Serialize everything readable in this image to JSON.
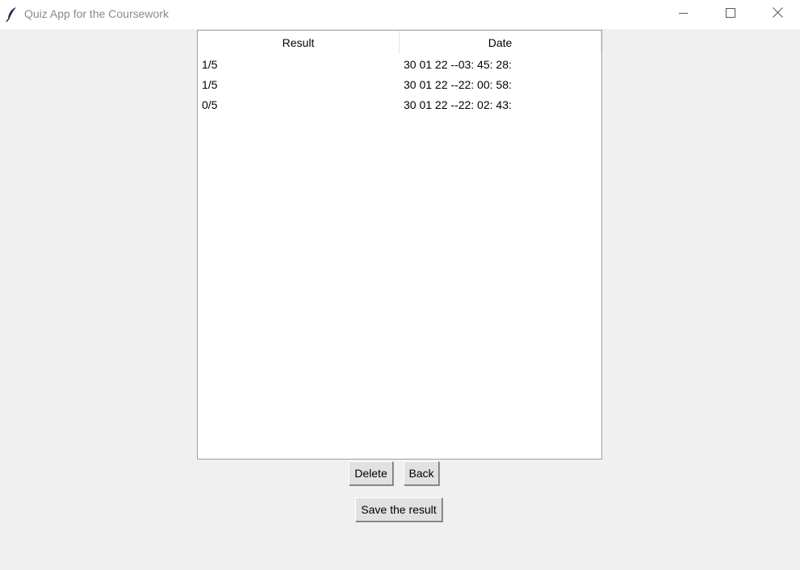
{
  "window": {
    "title": "Quiz App for the Coursework",
    "icon": "feather-icon",
    "controls": [
      "minimize-icon",
      "maximize-icon",
      "close-icon"
    ]
  },
  "table": {
    "columns": [
      "Result",
      "Date"
    ],
    "rows": [
      {
        "result": "1/5",
        "date": "30 01 22 --03: 45: 28:"
      },
      {
        "result": "1/5",
        "date": "30 01 22 --22: 00: 58:"
      },
      {
        "result": "0/5",
        "date": "30 01 22 --22: 02: 43:"
      }
    ]
  },
  "buttons": {
    "delete": "Delete",
    "back": "Back",
    "save": "Save the result"
  }
}
